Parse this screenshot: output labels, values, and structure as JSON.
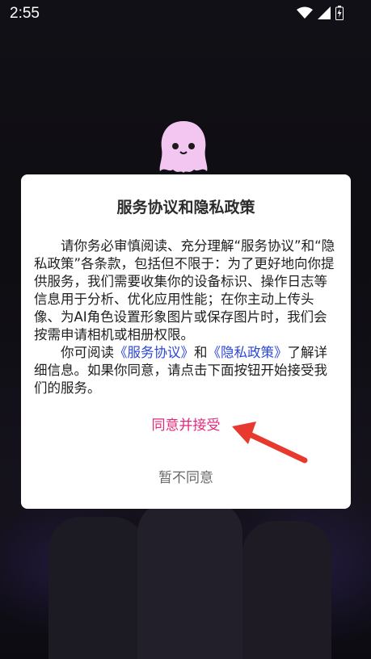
{
  "status_bar": {
    "time": "2:55",
    "icons": [
      "wifi-icon",
      "signal-icon",
      "battery-icon"
    ]
  },
  "dialog": {
    "title": "服务协议和隐私政策",
    "paragraph1": "请你务必审慎阅读、充分理解“服务协议”和“隐私政策”各条款，包括但不限于：为了更好地向你提供服务，我们需要收集你的设备标识、操作日志等信息用于分析、优化应用性能；在你主动上传头像、为AI角色设置形象图片或保存图片时，我们会按需申请相机或相册权限。",
    "paragraph2_prefix": "你可阅读",
    "service_link": "《服务协议》",
    "paragraph2_and": "和",
    "privacy_link": "《隐私政策》",
    "paragraph2_suffix": "了解详细信息。如果你同意，请点击下面按钮开始接受我们的服务。",
    "accept_label": "同意并接受",
    "decline_label": "暂不同意"
  },
  "colors": {
    "accept": "#e0297d",
    "link": "#2a46d8",
    "arrow": "#e8392e",
    "mascot": "#f2c6f0"
  }
}
